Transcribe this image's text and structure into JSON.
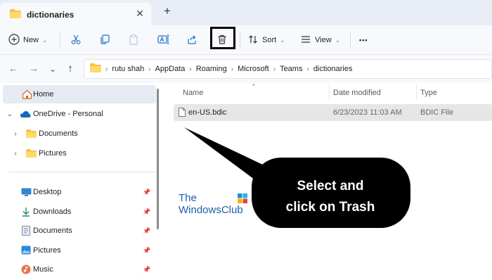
{
  "tab": {
    "title": "dictionaries",
    "close": "✕",
    "new_tab": "+"
  },
  "toolbar": {
    "new_label": "New",
    "sort_label": "Sort",
    "view_label": "View",
    "more": "•••"
  },
  "address": {
    "breadcrumbs": [
      "rutu shah",
      "AppData",
      "Roaming",
      "Microsoft",
      "Teams",
      "dictionaries"
    ]
  },
  "nav": {
    "home": "Home",
    "onedrive": "OneDrive - Personal",
    "documents": "Documents",
    "pictures": "Pictures",
    "quick_access": [
      {
        "label": "Desktop",
        "icon": "desktop-icon"
      },
      {
        "label": "Downloads",
        "icon": "download-icon"
      },
      {
        "label": "Documents",
        "icon": "documents-icon"
      },
      {
        "label": "Pictures",
        "icon": "pictures-icon"
      },
      {
        "label": "Music",
        "icon": "music-icon"
      }
    ]
  },
  "columns": {
    "name": "Name",
    "date": "Date modified",
    "type": "Type"
  },
  "files": [
    {
      "name": "en-US.bdic",
      "date": "6/23/2023 11:03 AM",
      "type": "BDIC File"
    }
  ],
  "watermark": {
    "line1": "The",
    "line2": "WindowsClub"
  },
  "callout": {
    "line1": "Select and",
    "line2": "click on Trash"
  },
  "colors": {
    "accent": "#0f6cbd",
    "folder": "#f5c342",
    "callout": "#000000",
    "watermark": "#1c5fa8"
  }
}
